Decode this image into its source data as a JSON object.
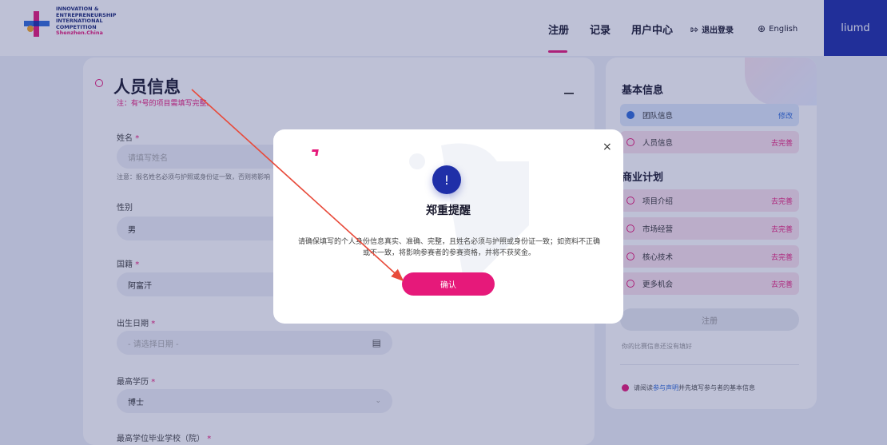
{
  "header": {
    "logo_lines": [
      "INNOVATION &",
      "ENTREPRENEURSHIP",
      "INTERNATIONAL",
      "COMPETITION"
    ],
    "logo_city": "Shenzhen.China",
    "nav": {
      "register": "注册",
      "records": "记录",
      "user_center": "用户中心",
      "logout": "退出登录",
      "language": "English"
    },
    "username": "liumd"
  },
  "form": {
    "title": "人员信息",
    "note": "注：有*号的项目需填写完整。",
    "name_label": "姓名",
    "name_placeholder": "请填写姓名",
    "name_note": "注意：报名姓名必须与护照或身份证一致，否则将影响",
    "gender_label": "性别",
    "gender_value": "男",
    "country_label": "国籍",
    "country_value": "阿富汗",
    "birth_label": "出生日期",
    "birth_placeholder": "- 请选择日期 -",
    "degree_label": "最高学历",
    "degree_value": "博士",
    "school_label": "最高学位毕业学校（院）",
    "required_mark": "*"
  },
  "sidebar": {
    "basic_title": "基本信息",
    "items_basic": [
      {
        "label": "团队信息",
        "action": "修改",
        "status": "done"
      },
      {
        "label": "人员信息",
        "action": "去完善",
        "status": "todo"
      }
    ],
    "plan_title": "商业计划",
    "items_plan": [
      {
        "label": "项目介绍",
        "action": "去完善"
      },
      {
        "label": "市场经营",
        "action": "去完善"
      },
      {
        "label": "核心技术",
        "action": "去完善"
      },
      {
        "label": "更多机会",
        "action": "去完善"
      }
    ],
    "register_button": "注册",
    "incomplete_note": "你的比赛信息还没有填好",
    "agree_prefix": "请阅读",
    "agree_link": "参与声明",
    "agree_suffix": "并先填写参与者的基本信息"
  },
  "modal": {
    "icon": "!",
    "title": "郑重提醒",
    "body": "请确保填写的个人身份信息真实、准确、完整，且姓名必须与护照或身份证一致；如资料不正确或不一致，将影响参赛者的参赛资格，并将不获奖金。",
    "confirm": "确认",
    "close": "×"
  },
  "colors": {
    "accent": "#e6197a",
    "brand": "#1f2fa8"
  }
}
